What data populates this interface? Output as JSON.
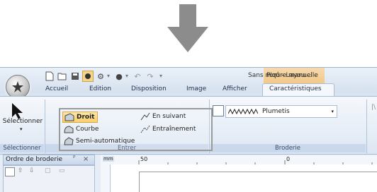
{
  "title_bar": {
    "document_title": "Sans nom - Layou...",
    "contextual_tab_title": "Piqûre manuelle"
  },
  "ribbon_tabs": [
    "Accueil",
    "Edition",
    "Disposition",
    "Image",
    "Afficher",
    "Caractéristiques"
  ],
  "active_tab": "Caractéristiques",
  "groups": {
    "selectionner": {
      "button_label": "Sélectionner",
      "group_label": "Sélectionner"
    },
    "entrer": {
      "group_label": "Entrer",
      "items": [
        "Droit",
        "Courbe",
        "Semi-automatique",
        "En suivant",
        "Entraînement"
      ],
      "selected": "Droit"
    },
    "broderie": {
      "group_label": "Broderie",
      "combo_value": "Plumetis"
    }
  },
  "panel": {
    "title": "Ordre de broderie",
    "pin": "ᴾ",
    "close": "×"
  },
  "ruler": {
    "unit": "mm",
    "marks": [
      "50",
      "0"
    ]
  },
  "colors": {
    "ribbon_bg": "#dde7f3",
    "selected_item": "#f9cf6e",
    "context_tab": "#f2c987",
    "arrow": "#8c8c8c"
  },
  "icons": [
    "down-arrow-icon",
    "app-orb-icon",
    "new-icon",
    "open-icon",
    "save-icon",
    "cursor-icon",
    "droit-icon",
    "courbe-icon",
    "semi-auto-icon",
    "en-suivant-icon",
    "entrainement-icon",
    "satin-icon",
    "plumetis-pattern-icon",
    "dropdown-icon"
  ]
}
